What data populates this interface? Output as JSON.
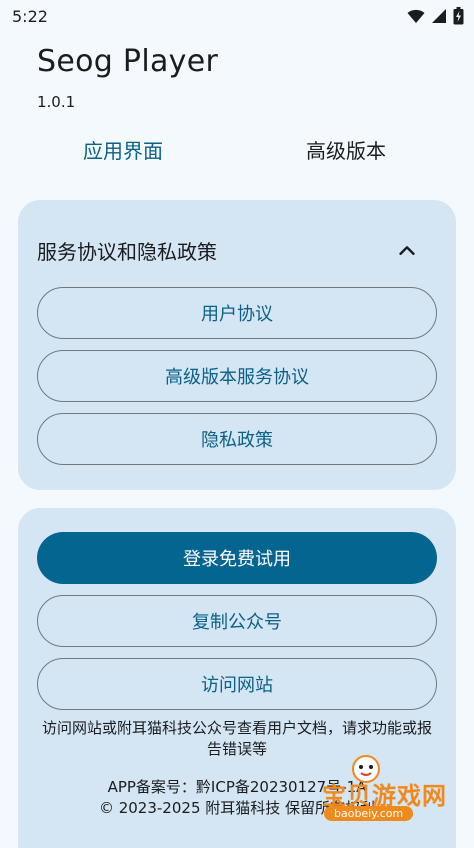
{
  "status": {
    "time": "5:22"
  },
  "app": {
    "title": "Seog Player",
    "version": "1.0.1"
  },
  "tabs": [
    {
      "label": "应用界面",
      "active": true
    },
    {
      "label": "高级版本",
      "active": false
    }
  ],
  "agreements": {
    "title": "服务协议和隐私政策",
    "buttons": [
      "用户协议",
      "高级版本服务协议",
      "隐私政策"
    ]
  },
  "actions": {
    "login_label": "登录免费试用",
    "copy_label": "复制公众号",
    "visit_label": "访问网站",
    "note": "访问网站或附耳猫科技公众号查看用户文档，请求功能或报告错误等",
    "icp": "APP备案号：黔ICP备20230127号-1A",
    "copyright": "© 2023-2025 附耳猫科技 保留所有权利"
  },
  "watermark": {
    "text": "宝贝游戏网",
    "url": "baobeiy.com"
  },
  "colors": {
    "accent": "#056591",
    "card": "#d4e5f3",
    "background": "#f4f9fe",
    "tab_active": "#0b6186"
  }
}
